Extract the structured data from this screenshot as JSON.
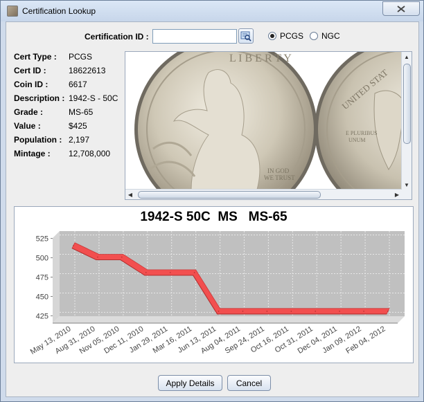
{
  "window": {
    "title": "Certification Lookup"
  },
  "lookup": {
    "cert_id_label": "Certification ID :",
    "cert_id_value": "",
    "radios": [
      {
        "label": "PCGS",
        "selected": true
      },
      {
        "label": "NGC",
        "selected": false
      }
    ]
  },
  "info": [
    {
      "key": "Cert Type :",
      "value": "PCGS"
    },
    {
      "key": "Cert ID :",
      "value": "18622613"
    },
    {
      "key": "Coin ID :",
      "value": "6617"
    },
    {
      "key": "Description :",
      "value": "1942-S - 50C"
    },
    {
      "key": "Grade :",
      "value": "MS-65"
    },
    {
      "key": "Value :",
      "value": "$425"
    },
    {
      "key": "Population :",
      "value": "2,197"
    },
    {
      "key": "Mintage :",
      "value": "12,708,000"
    }
  ],
  "coin_image": {
    "obverse_text": [
      "LIBERTY",
      "IN GOD",
      "WE TRUST"
    ],
    "reverse_text": [
      "UNITED STATES",
      "E PLURIBUS",
      "UNUM"
    ]
  },
  "chart_data": {
    "type": "area",
    "title": "1942-S 50C  MS   MS-65",
    "xlabel": "",
    "ylabel": "",
    "categories": [
      "May 13, 2010",
      "Aug 31, 2010",
      "Nov 05, 2010",
      "Dec 11, 2010",
      "Jan 29, 2011",
      "Mar 16, 2011",
      "Jun 13, 2011",
      "Aug 04, 2011",
      "Sep 24, 2011",
      "Oct 16, 2011",
      "Oct 31, 2011",
      "Dec 04, 2011",
      "Jan 09, 2012",
      "Feb 04, 2012"
    ],
    "values": [
      515,
      500,
      500,
      480,
      480,
      480,
      430,
      430,
      430,
      430,
      430,
      430,
      430,
      430
    ],
    "ylim": [
      420,
      530
    ],
    "yticks": [
      425,
      450,
      475,
      500,
      525
    ],
    "grid": true,
    "legend": "none",
    "series_color": "#f24f4f",
    "plot_bg": "#c0c0c0"
  },
  "buttons": {
    "apply": "Apply Details",
    "cancel": "Cancel"
  }
}
